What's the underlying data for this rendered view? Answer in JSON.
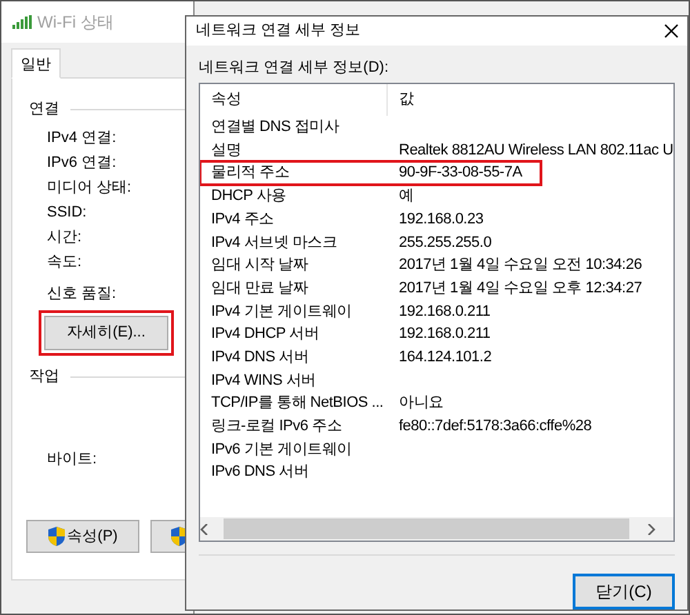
{
  "back_window": {
    "title": "Wi-Fi 상태",
    "tabs": [
      {
        "label": "일반",
        "selected": true
      }
    ],
    "connection_group": {
      "title": "연결",
      "fields": [
        "IPv4 연결:",
        "IPv6 연결:",
        "미디어 상태:",
        "SSID:",
        "시간:",
        "속도:",
        "신호 품질:"
      ]
    },
    "details_button": {
      "label": "자세히(E)...",
      "highlighted": true
    },
    "activity_group": {
      "title": "작업",
      "fields": [
        "바이트:"
      ]
    },
    "buttons": [
      {
        "kind": "shield",
        "label": "속성(P)"
      },
      {
        "kind": "shield"
      }
    ]
  },
  "dialog": {
    "title": "네트워크 연결 세부 정보",
    "list_label": "네트워크 연결 세부 정보(D):",
    "columns": [
      "속성",
      "값"
    ],
    "rows": [
      {
        "property": "연결별 DNS 접미사",
        "highlighted": false
      },
      {
        "property": "설명",
        "value": "Realtek 8812AU Wireless LAN 802.11ac U",
        "highlighted": false
      },
      {
        "property": "물리적 주소",
        "value": "90-9F-33-08-55-7A",
        "highlighted": true
      },
      {
        "property": "DHCP 사용",
        "value": "예",
        "highlighted": false
      },
      {
        "property": "IPv4 주소",
        "value": "192.168.0.23",
        "highlighted": false
      },
      {
        "property": "IPv4 서브넷 마스크",
        "value": "255.255.255.0",
        "highlighted": false
      },
      {
        "property": "임대 시작 날짜",
        "value": "2017년 1월 4일 수요일 오전 10:34:26",
        "highlighted": false
      },
      {
        "property": "임대 만료 날짜",
        "value": "2017년 1월 4일 수요일 오후 12:34:27",
        "highlighted": false
      },
      {
        "property": "IPv4 기본 게이트웨이",
        "value": "192.168.0.211",
        "highlighted": false
      },
      {
        "property": "IPv4 DHCP 서버",
        "value": "192.168.0.211",
        "highlighted": false
      },
      {
        "property": "IPv4 DNS 서버",
        "value": "164.124.101.2",
        "highlighted": false
      },
      {
        "property": "IPv4 WINS 서버",
        "highlighted": false
      },
      {
        "property": "TCP/IP를 통해 NetBIOS ...",
        "value": "아니요",
        "highlighted": false
      },
      {
        "property": "링크-로컬 IPv6 주소",
        "value": "fe80::7def:5178:3a66:cffe%28",
        "highlighted": false
      },
      {
        "property": "IPv6 기본 게이트웨이",
        "highlighted": false
      },
      {
        "property": "IPv6 DNS 서버",
        "highlighted": false
      }
    ],
    "close_button": "닫기(C)"
  }
}
